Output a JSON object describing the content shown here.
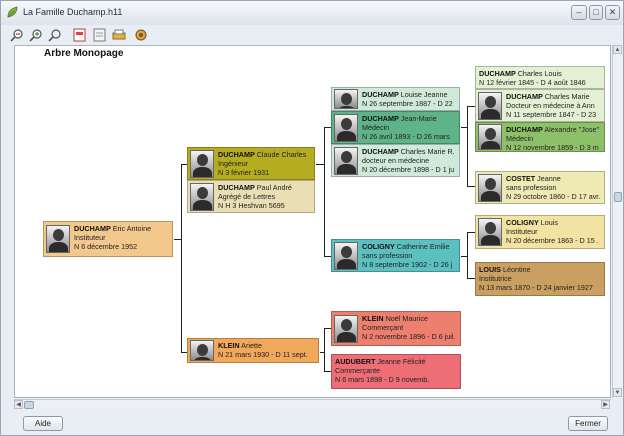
{
  "window": {
    "title": "La Famille Duchamp.h11",
    "controls": [
      "–",
      "□",
      "✕"
    ]
  },
  "toolbar": {
    "icons": [
      "zoom-out-icon",
      "zoom-in-icon",
      "zoom-fit-icon",
      "tree-pdf-icon",
      "export-icon",
      "print-icon",
      "settings-icon"
    ]
  },
  "tree": {
    "heading": "Arbre Monopage",
    "people": [
      {
        "id": "p1",
        "surname": "DUCHAMP",
        "given": "Eric Antoine",
        "lines": [
          "Instituteur",
          "N 6 décembre 1952"
        ],
        "color": "#f2c88c",
        "photo": true
      },
      {
        "id": "p2",
        "surname": "DUCHAMP",
        "given": "Claude Charles",
        "lines": [
          "Ingénieur",
          "N 3 février 1931"
        ],
        "color": "#b6ac22",
        "photo": true
      },
      {
        "id": "p3",
        "surname": "DUCHAMP",
        "given": "Paul André",
        "lines": [
          "Agrégé de Lettres",
          "N H 3 Heshvan 5695"
        ],
        "color": "#eadfb4",
        "photo": true
      },
      {
        "id": "p4",
        "surname": "KLEIN",
        "given": "Ariette",
        "lines": [
          "N 21 mars 1930 - D 11 sept."
        ],
        "color": "#f2a85a",
        "photo": true
      },
      {
        "id": "p5",
        "surname": "DUCHAMP",
        "given": "Louise Jeanne",
        "lines": [
          "N 26 septembre 1887 - D 22"
        ],
        "color": "#cfe9da",
        "photo": true
      },
      {
        "id": "p6",
        "surname": "DUCHAMP",
        "given": "Jean-Marie",
        "lines": [
          "Médecin",
          "N 26 avril 1893 - D 26 mars"
        ],
        "color": "#5fb388",
        "photo": true
      },
      {
        "id": "p7",
        "surname": "DUCHAMP",
        "given": "Charles Marie R.",
        "lines": [
          "docteur en médecine",
          "N 20 décembre 1898 - D 1 ju"
        ],
        "color": "#cfe9da",
        "photo": true
      },
      {
        "id": "p8",
        "surname": "COLIGNY",
        "given": "Catherine Emilie",
        "lines": [
          "sans profession",
          "N 8 septembre 1902 - D 26 j"
        ],
        "color": "#5cc0c0",
        "photo": true
      },
      {
        "id": "p9",
        "surname": "KLEIN",
        "given": "Noël Maurice",
        "lines": [
          "Commerçant",
          "N 2 novembre 1896 - D 6 juil."
        ],
        "color": "#ec7f6e",
        "photo": true
      },
      {
        "id": "p10",
        "surname": "AUDUBERT",
        "given": "Jeanne Félicité",
        "lines": [
          "Commerçante",
          "N 6 mars 1898 - D 9 novemb."
        ],
        "color": "#ee6e76",
        "photo": false
      },
      {
        "id": "p11",
        "surname": "DUCHAMP",
        "given": "Charles Louis",
        "lines": [
          "N 12 février 1845 - D 4 août 1846"
        ],
        "color": "#e4f0d4",
        "photo": false
      },
      {
        "id": "p12",
        "surname": "DUCHAMP",
        "given": "Charles Marie",
        "lines": [
          "Docteur en médecine à Ann",
          "N 11 septembre 1847 - D 23"
        ],
        "color": "#e4f0d4",
        "photo": true
      },
      {
        "id": "p13",
        "surname": "DUCHAMP",
        "given": "Alexandre \"Jose\"",
        "lines": [
          "Médecin",
          "N 12 novembre 1859 - D 3 m"
        ],
        "color": "#8ec06a",
        "photo": true
      },
      {
        "id": "p14",
        "surname": "COSTET",
        "given": "Jeanne",
        "lines": [
          "sans profession",
          "N 29 octobre 1860 - D 17 avr."
        ],
        "color": "#efe9b4",
        "photo": true
      },
      {
        "id": "p15",
        "surname": "COLIGNY",
        "given": "Louis",
        "lines": [
          "Instituteur",
          "N 20 décembre 1863 - D 15 ."
        ],
        "color": "#f2e3a2",
        "photo": true
      },
      {
        "id": "p16",
        "surname": "LOUIS",
        "given": "Léontine",
        "lines": [
          "Institutrice",
          "N 13 mars 1870 - D 24 janvier 1927"
        ],
        "color": "#caa062",
        "photo": false
      }
    ]
  },
  "footer": {
    "help_label": "Aide",
    "close_label": "Fermer"
  }
}
